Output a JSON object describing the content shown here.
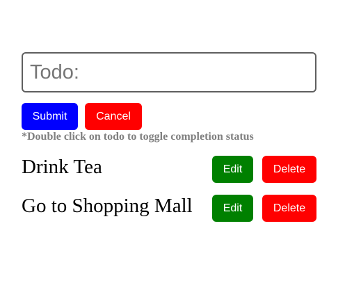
{
  "form": {
    "input_value": "",
    "input_placeholder": "Todo:",
    "submit_label": "Submit",
    "cancel_label": "Cancel"
  },
  "hint": "*Double click on todo to toggle completion status",
  "todos": [
    {
      "text": "Drink Tea",
      "edit_label": "Edit",
      "delete_label": "Delete"
    },
    {
      "text": "Go to Shopping Mall",
      "edit_label": "Edit",
      "delete_label": "Delete"
    }
  ],
  "colors": {
    "submit": "#0000ff",
    "cancel": "#ff0000",
    "edit": "#008000",
    "delete": "#ff0000",
    "hint": "#808080"
  }
}
